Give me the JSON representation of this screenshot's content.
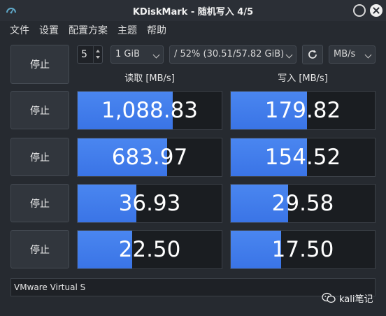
{
  "window": {
    "title": "KDiskMark - 随机写入 4/5"
  },
  "menu": [
    "文件",
    "设置",
    "配置方案",
    "主题",
    "帮助"
  ],
  "controls": {
    "runs": "5",
    "size": "1 GiB",
    "drive": "/ 52% (30.51/57.82 GiB)",
    "unit": "MB/s"
  },
  "headers": {
    "read": "读取 [MB/s]",
    "write": "写入 [MB/s]"
  },
  "rows": [
    {
      "button": "停止",
      "read": "1,088.83",
      "write": "179.82",
      "read_fill": 0.66,
      "write_fill": 0.53
    },
    {
      "button": "停止",
      "read": "683.97",
      "write": "154.52",
      "read_fill": 0.62,
      "write_fill": 0.53
    },
    {
      "button": "停止",
      "read": "36.93",
      "write": "29.58",
      "read_fill": 0.41,
      "write_fill": 0.4
    },
    {
      "button": "停止",
      "read": "22.50",
      "write": "17.50",
      "read_fill": 0.38,
      "write_fill": 0.35
    }
  ],
  "device": "VMware Virtual S",
  "watermark": "kali笔记",
  "colors": {
    "bar": "#3d7ae8",
    "background": "#262a30"
  }
}
